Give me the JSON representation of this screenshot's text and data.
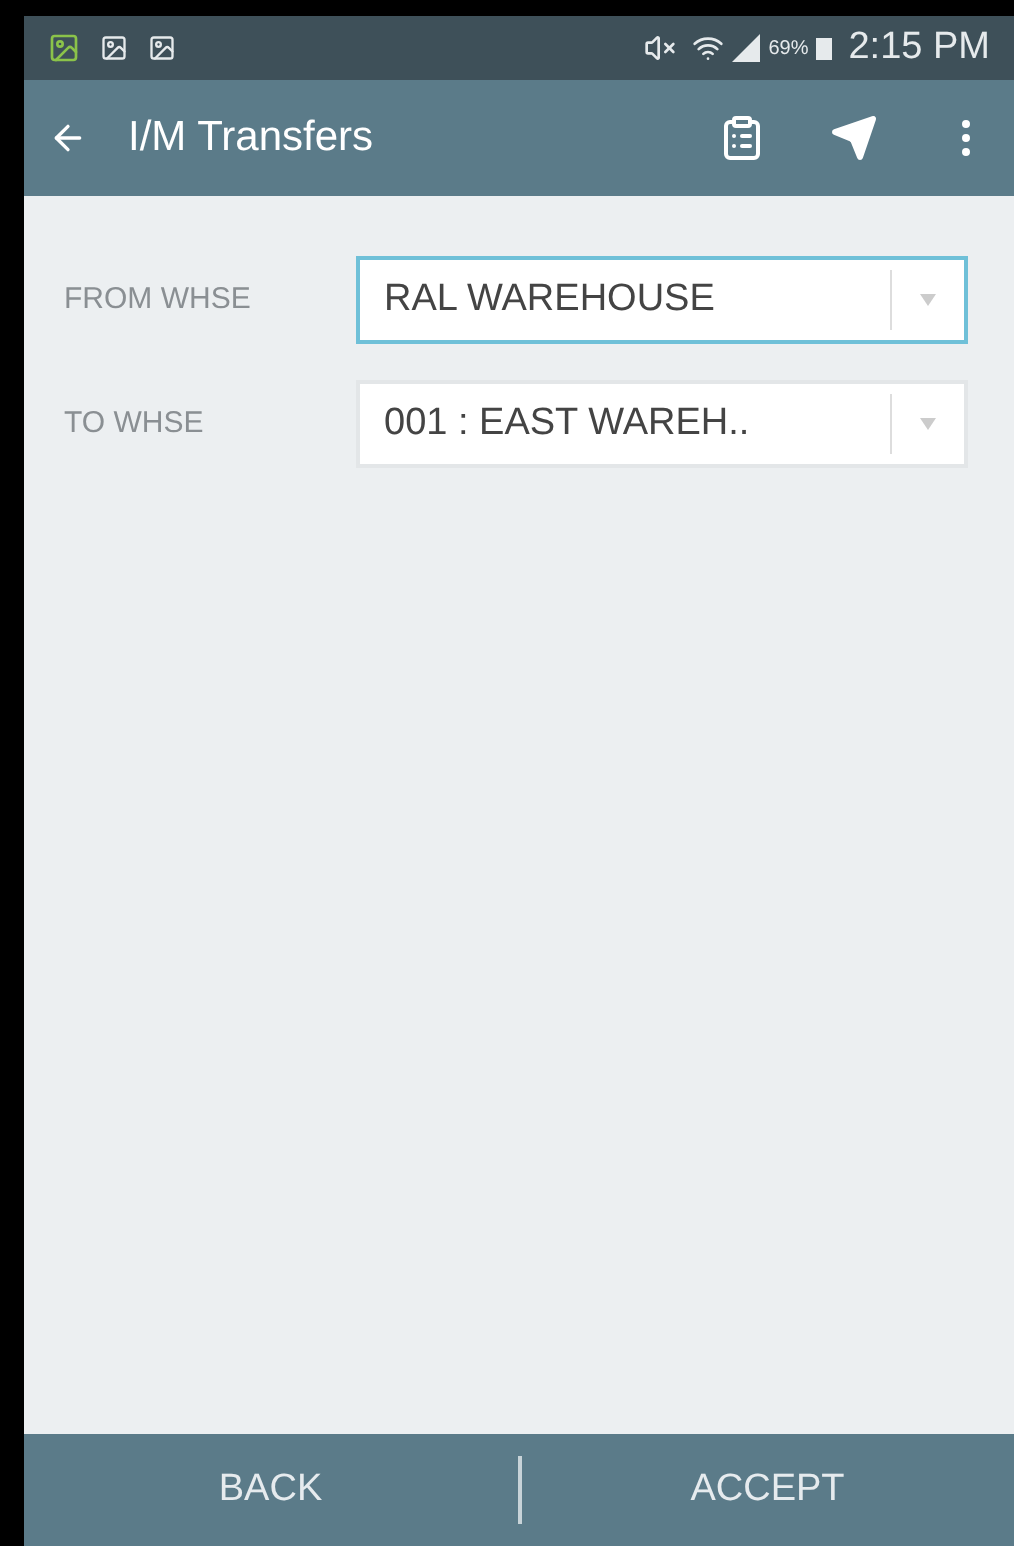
{
  "status_bar": {
    "battery": "69%",
    "time": "2:15 PM"
  },
  "app_bar": {
    "title": "I/M Transfers"
  },
  "fields": [
    {
      "label": "FROM WHSE",
      "value": "RAL WAREHOUSE",
      "focused": true
    },
    {
      "label": "TO WHSE",
      "value": "001 : EAST WAREH..",
      "focused": false
    }
  ],
  "buttons": [
    "BACK",
    "ACCEPT"
  ]
}
